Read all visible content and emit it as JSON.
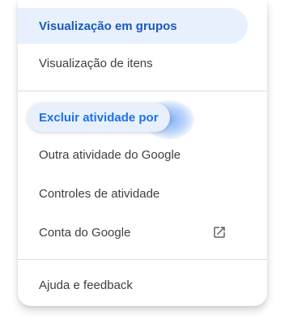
{
  "menu": {
    "items": [
      {
        "label": "Visualização em grupos"
      },
      {
        "label": "Visualização de itens"
      },
      {
        "label": "Excluir atividade por"
      },
      {
        "label": "Outra atividade do Google"
      },
      {
        "label": "Controles de atividade"
      },
      {
        "label": "Conta do Google",
        "icon": "open-in-new-icon"
      },
      {
        "label": "Ajuda e feedback"
      }
    ]
  },
  "colors": {
    "active_background": "#e8f0fe",
    "active_text": "#185abc",
    "focus_text": "#1a73e8",
    "text": "#3c4043",
    "divider": "#dadce0"
  }
}
